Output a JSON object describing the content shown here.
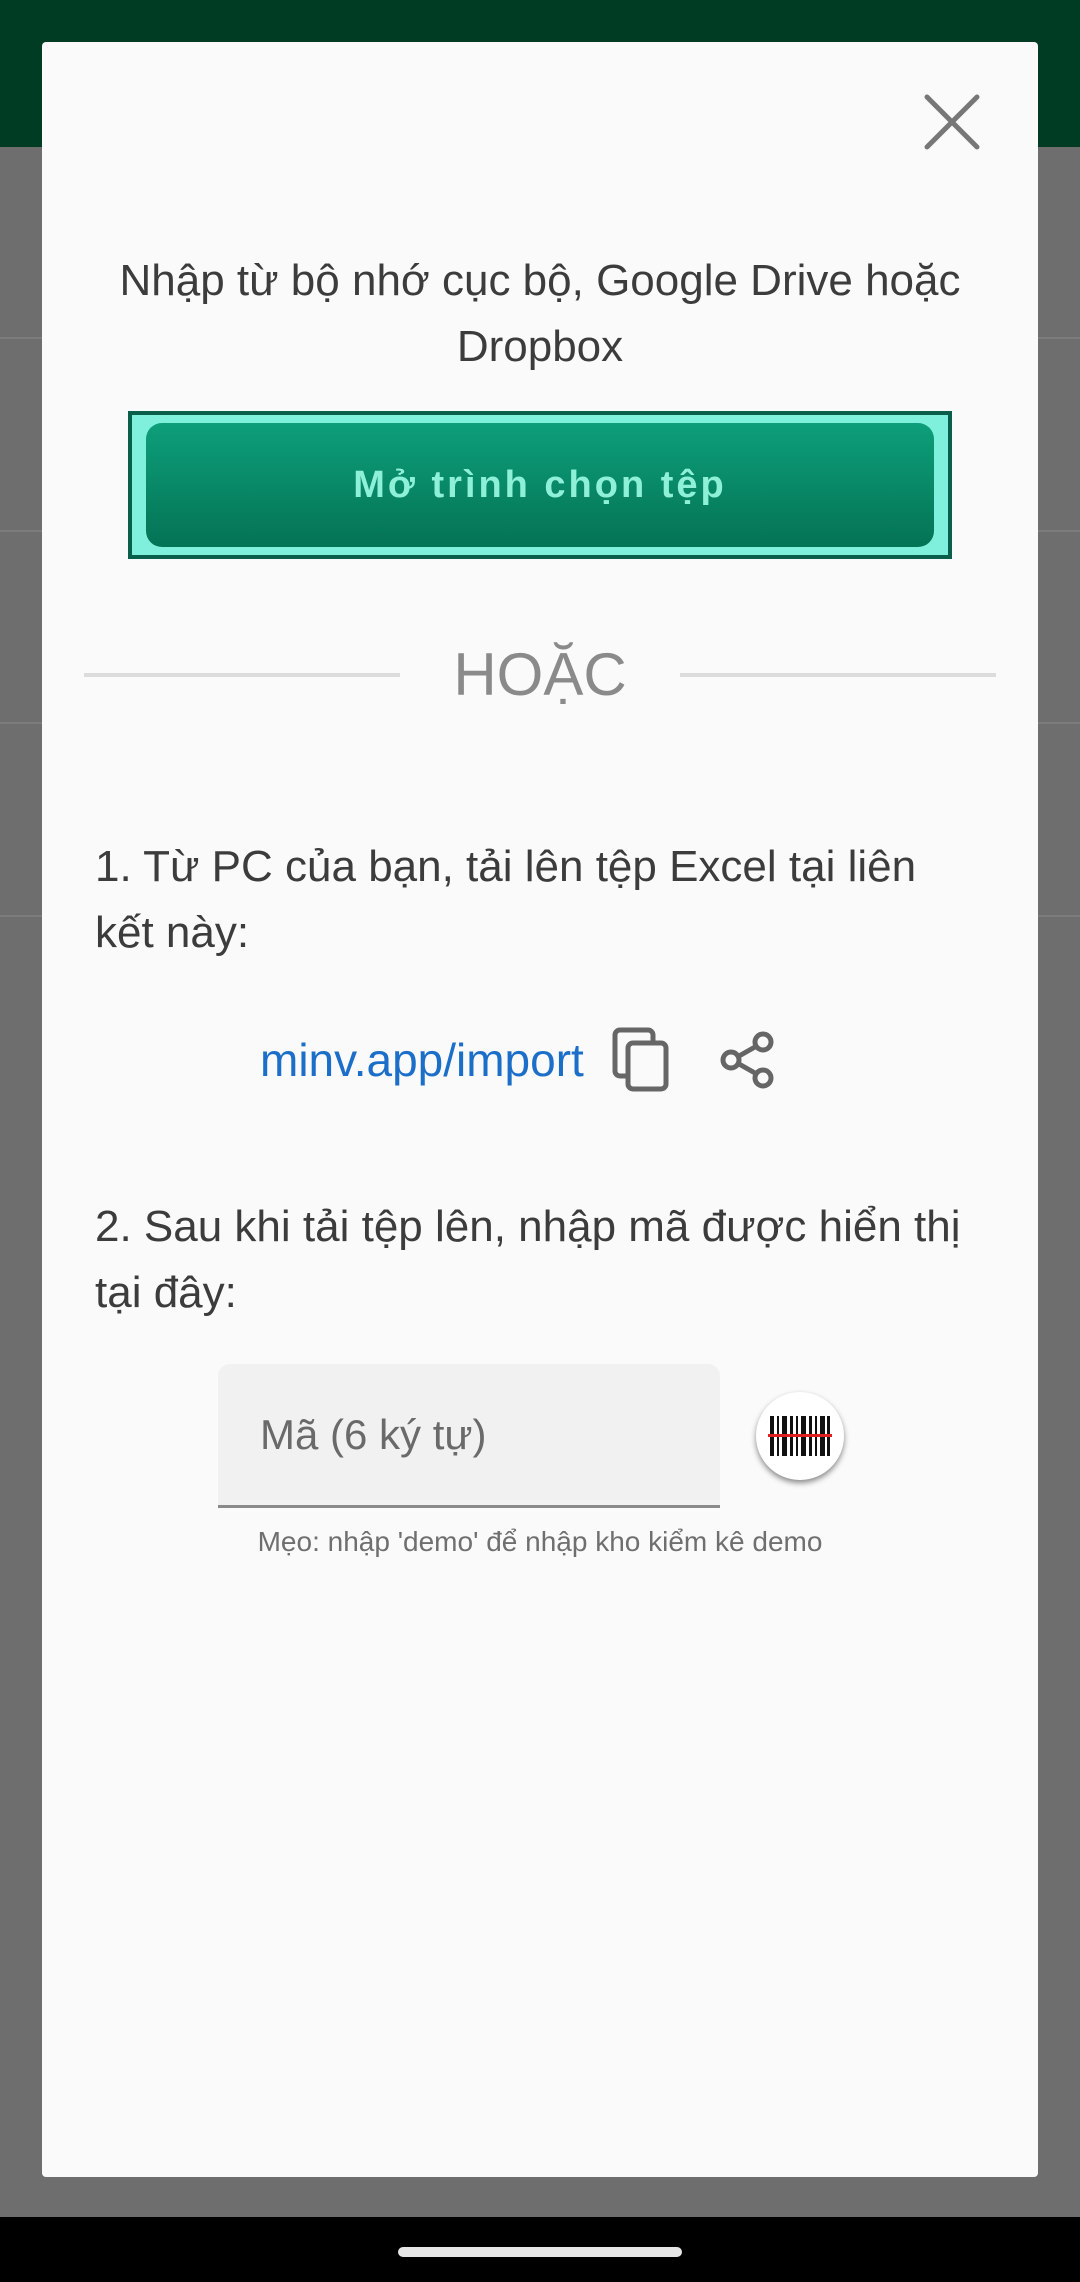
{
  "dialog": {
    "intro_text": "Nhập từ bộ nhớ cục bộ, Google Drive hoặc Dropbox",
    "open_picker_label": "Mở trình chọn tệp",
    "or_label": "HOẶC",
    "step1_text": "1. Từ PC của bạn, tải lên tệp Excel tại liên kết này:",
    "import_link": "minv.app/import",
    "step2_text": "2. Sau khi tải tệp lên, nhập mã được hiển thị tại đây:",
    "code_placeholder": "Mã (6 ký tự)",
    "tip_text": "Mẹo: nhập 'demo' để nhập kho kiểm kê demo"
  },
  "icons": {
    "close": "close-icon",
    "copy": "copy-icon",
    "share": "share-icon",
    "scan": "barcode-scan-icon"
  },
  "colors": {
    "accent": "#047354",
    "link": "#1c6fc9",
    "appbar": "#003b24"
  }
}
